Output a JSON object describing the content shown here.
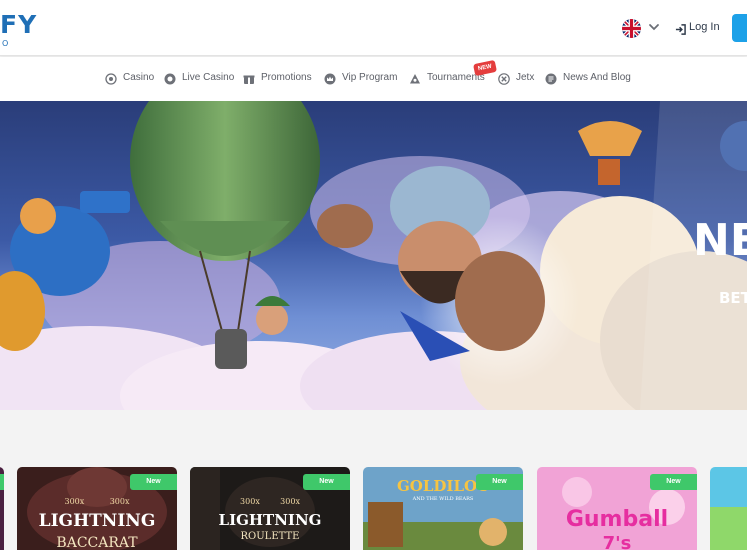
{
  "brand": {
    "logo_main": "FY",
    "logo_sub": "O"
  },
  "header": {
    "language_icon": "uk-flag-icon",
    "login_label": "Log In"
  },
  "nav": {
    "items": [
      {
        "label": "Casino",
        "icon": "casino-chip-icon"
      },
      {
        "label": "Live Casino",
        "icon": "live-casino-icon"
      },
      {
        "label": "Promotions",
        "icon": "gift-icon"
      },
      {
        "label": "Vip Program",
        "icon": "crown-icon"
      },
      {
        "label": "Tournaments",
        "icon": "trophy-icon",
        "badge": "NEW"
      },
      {
        "label": "Jetx",
        "icon": "jetx-icon"
      },
      {
        "label": "News And Blog",
        "icon": "news-icon"
      }
    ]
  },
  "hero": {
    "title": "NE",
    "subtitle": "BET"
  },
  "games": [
    {
      "name": "LIGHTNING",
      "subtitle": "BACCARAT",
      "multiplier_left": "300x",
      "multiplier_right": "300x",
      "badge": "New"
    },
    {
      "name": "LIGHTNING",
      "subtitle": "ROULETTE",
      "multiplier_left": "300x",
      "multiplier_right": "300x",
      "badge": "New"
    },
    {
      "name": "GOLDILOC",
      "subtitle": "AND THE WILD BEARS",
      "badge": "New"
    },
    {
      "name": "Gumball",
      "subtitle": "7's",
      "badge": "New"
    }
  ],
  "colors": {
    "brand_blue": "#1f6fb6",
    "register_button": "#1da1e8",
    "new_badge_green": "#3fc86a",
    "nav_new_red": "#e43d3d"
  }
}
